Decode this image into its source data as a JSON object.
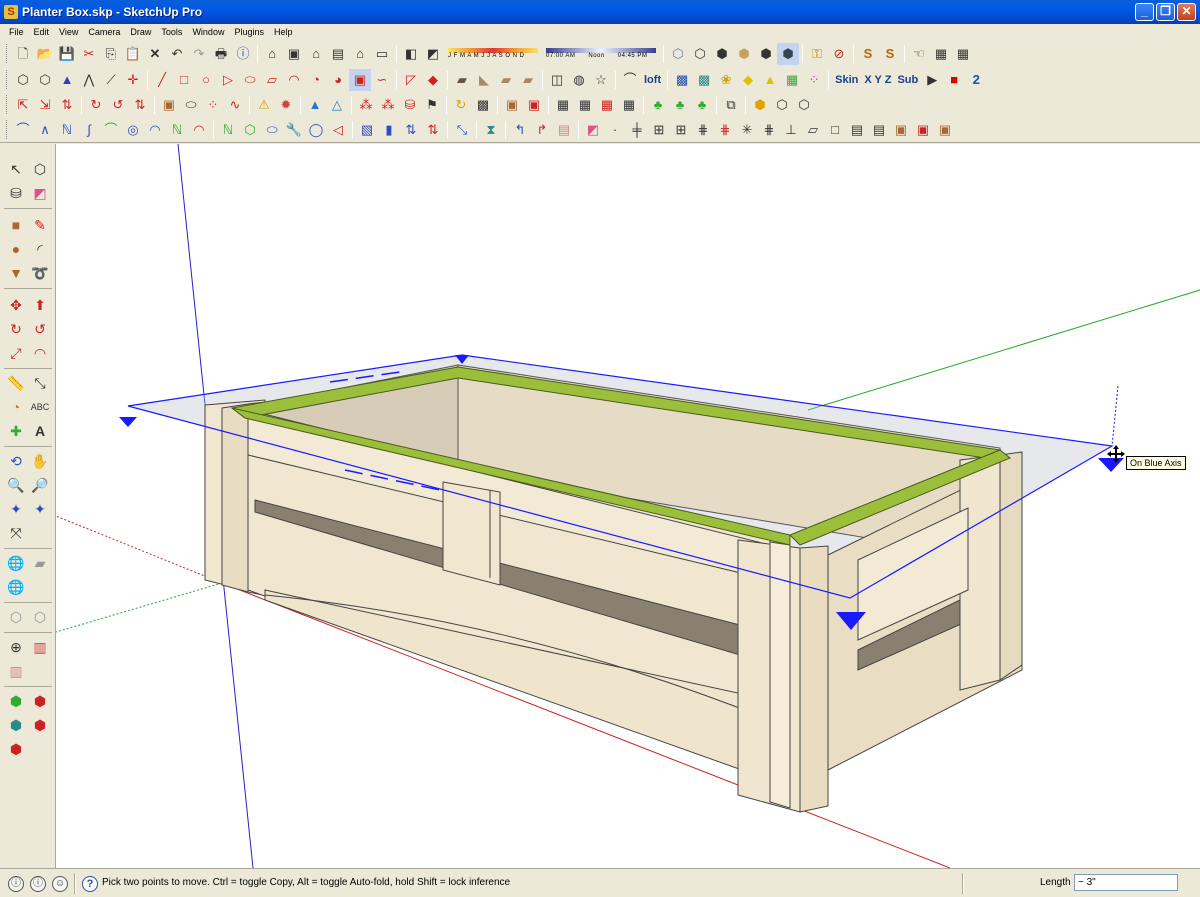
{
  "window": {
    "title": "Planter Box.skp - SketchUp Pro",
    "app_icon": "S",
    "controls": [
      "_",
      "❐",
      "✕"
    ]
  },
  "menu": [
    "File",
    "Edit",
    "View",
    "Camera",
    "Draw",
    "Tools",
    "Window",
    "Plugins",
    "Help"
  ],
  "shadow_widget": {
    "months": "J F M A M J J A S O N D",
    "time_start": "07:00 AM",
    "time_mid": "Noon",
    "time_end": "04:45 PM"
  },
  "plugin_labels": {
    "loft": "loft",
    "skin": "Skin",
    "xyz": "X Y Z",
    "sub": "Sub"
  },
  "viewport": {
    "tooltip": "On Blue Axis",
    "axis_colors": {
      "red": "#cc2222",
      "green": "#22aa22",
      "blue": "#2222cc"
    },
    "wood_color": "#efe4cc",
    "rim_color": "#9bbf3a",
    "selection_color": "#1a1aff"
  },
  "statusbar": {
    "message": "Pick two points to move.  Ctrl = toggle Copy, Alt = toggle Auto-fold, hold Shift = lock inference",
    "help_icon": "?",
    "length_label": "Length",
    "length_value": "~ 3\""
  }
}
